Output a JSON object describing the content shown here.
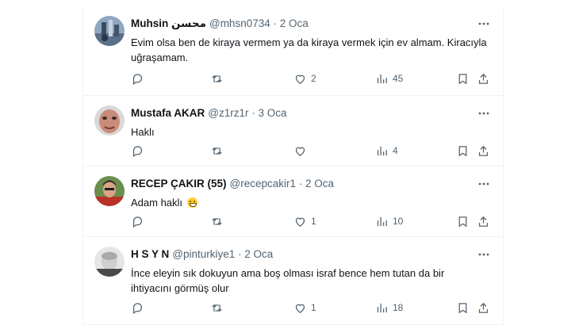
{
  "tweets": [
    {
      "name": "Muhsin محسن",
      "handle": "@mhsn0734 · 2 Oca",
      "text": "Evim olsa ben de kiraya vermem ya da kiraya vermek için ev almam. Kiracıyla uğraşamam.",
      "likes": "2",
      "views": "45",
      "retweets": "",
      "replies": ""
    },
    {
      "name": "Mustafa AKAR",
      "handle": "@z1rz1r · 3 Oca",
      "text": "Haklı",
      "likes": "",
      "views": "4",
      "retweets": "",
      "replies": ""
    },
    {
      "name": "RECEP ÇAKIR (55)",
      "handle": "@recepcakir1 · 2 Oca",
      "text": "Adam haklı",
      "likes": "1",
      "views": "10",
      "retweets": "",
      "replies": ""
    },
    {
      "name": "H S Y N",
      "handle": "@pinturkiye1 · 2 Oca",
      "text": "İnce eleyin sık dokuyun ama boş olması israf bence hem tutan da bir ihtiyacını görmüş olur",
      "likes": "1",
      "views": "18",
      "retweets": "",
      "replies": ""
    }
  ],
  "colors": {
    "text": "#0f1419",
    "muted": "#536471",
    "border": "#eff3f4"
  },
  "icons": [
    "reply-icon",
    "retweet-icon",
    "like-icon",
    "views-icon",
    "bookmark-icon",
    "share-icon",
    "more-icon"
  ]
}
